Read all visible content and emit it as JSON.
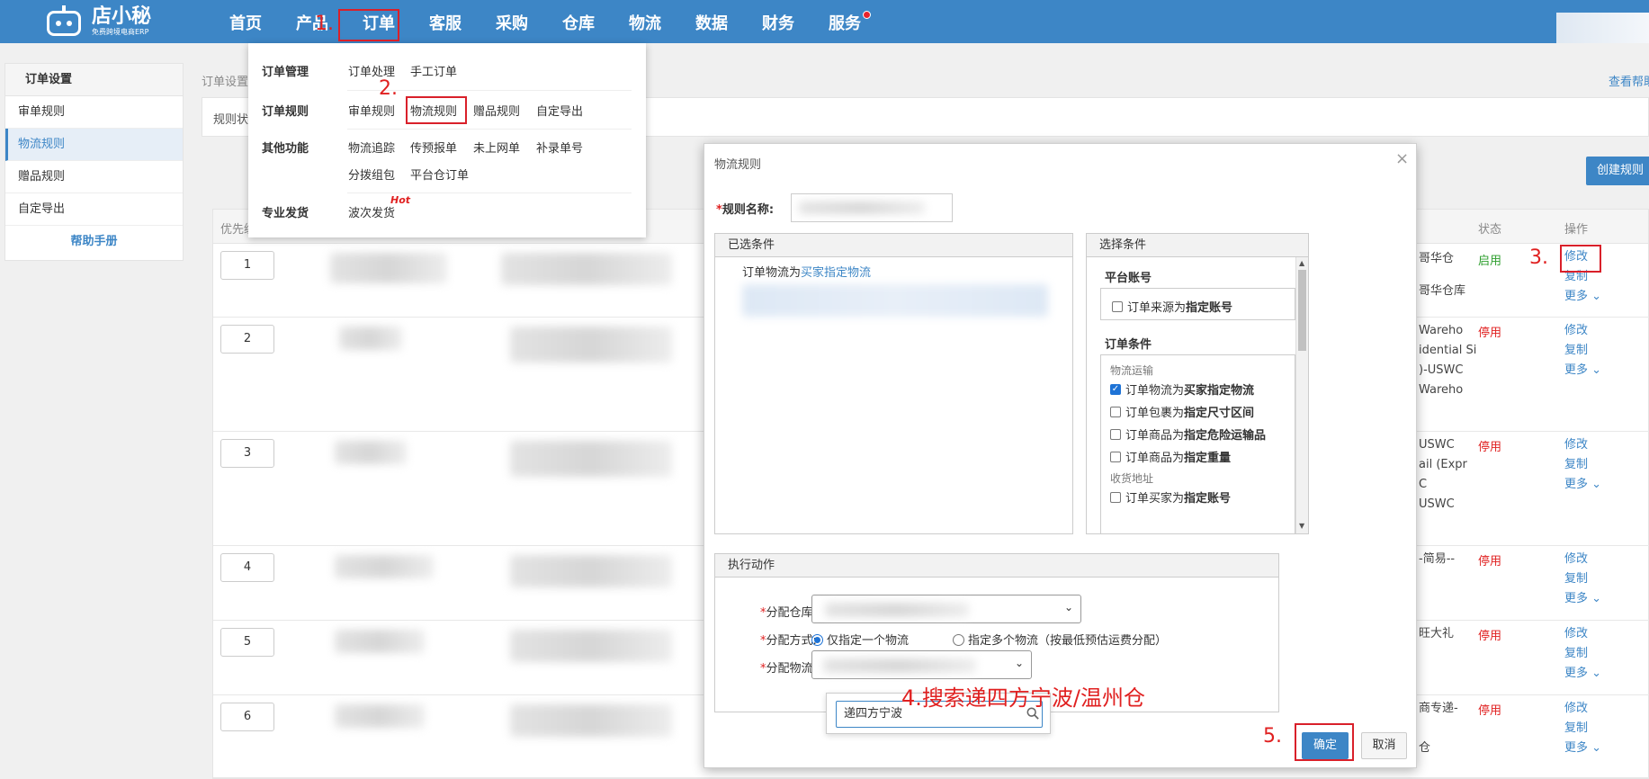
{
  "header": {
    "logo_name": "店小秘",
    "logo_sub": "免费跨境电商ERP",
    "nav": [
      "首页",
      "产品",
      "订单",
      "客服",
      "采购",
      "仓库",
      "物流",
      "数据",
      "财务",
      "服务"
    ]
  },
  "annotations": {
    "step1": "1.",
    "step2": "2.",
    "step3": "3.",
    "step4": "4.搜索递四方宁波/温州仓",
    "step5": "5."
  },
  "sidebar": {
    "title": "订单设置",
    "items": [
      "审单规则",
      "物流规则",
      "赠品规则",
      "自定导出"
    ],
    "active": "物流规则",
    "help": "帮助手册"
  },
  "page": {
    "breadcrumb": "订单设置",
    "help_link": "查看帮助",
    "status_label": "规则状",
    "create_button": "创建规则"
  },
  "table": {
    "col_priority": "优先级",
    "col_status": "状态",
    "col_ops": "操作",
    "op_edit": "修改",
    "op_copy": "复制",
    "op_more": "更多 ⌄",
    "rows": [
      {
        "priority": "1",
        "status": "启用",
        "active": true,
        "snippets": [
          "哥华仓",
          "哥华仓库"
        ]
      },
      {
        "priority": "2",
        "status": "停用",
        "active": false,
        "snippets": [
          "Wareho",
          "idential Si",
          ")-USWC",
          "Wareho"
        ]
      },
      {
        "priority": "3",
        "status": "停用",
        "active": false,
        "snippets": [
          "USWC",
          "ail (Expr",
          "C",
          "USWC"
        ]
      },
      {
        "priority": "4",
        "status": "停用",
        "active": false,
        "snippets": [
          "-简易--"
        ]
      },
      {
        "priority": "5",
        "status": "停用",
        "active": false,
        "snippets": [
          "旺大礼"
        ]
      },
      {
        "priority": "6",
        "status": "停用",
        "active": false,
        "snippets": [
          "商专递-",
          "仓"
        ]
      }
    ]
  },
  "dropdown": {
    "groups": [
      {
        "head": "订单管理",
        "links": [
          "订单处理",
          "手工订单"
        ]
      },
      {
        "head": "订单规则",
        "links": [
          "审单规则",
          "物流规则",
          "赠品规则",
          "自定导出"
        ]
      },
      {
        "head": "其他功能",
        "links": [
          "物流追踪",
          "传预报单",
          "未上网单",
          "补录单号",
          "分拨组包",
          "平台仓订单"
        ]
      },
      {
        "head": "专业发货",
        "links": [
          "波次发货"
        ]
      }
    ],
    "hot": "Hot"
  },
  "modal": {
    "title": "物流规则",
    "close": "×",
    "rule_name_label": "规则名称:",
    "required_mark": "*",
    "selected_panel_title": "已选条件",
    "selected_condition_prefix": "订单物流为",
    "selected_condition_link": "买家指定物流",
    "choose_panel_title": "选择条件",
    "platform_account_head": "平台账号",
    "platform_account_option_prefix": "订单来源为",
    "platform_account_option_bold": "指定账号",
    "order_condition_head": "订单条件",
    "group_logistics": "物流运输",
    "group_address": "收货地址",
    "options": [
      {
        "prefix": "订单物流为",
        "bold": "买家指定物流",
        "checked": true
      },
      {
        "prefix": "订单包裹为",
        "bold": "指定尺寸区间",
        "checked": false
      },
      {
        "prefix": "订单商品为",
        "bold": "指定危险运输品",
        "checked": false
      },
      {
        "prefix": "订单商品为",
        "bold": "指定重量",
        "checked": false
      },
      {
        "prefix": "订单买家为",
        "bold": "指定账号",
        "checked": false
      }
    ],
    "action_panel_title": "执行动作",
    "warehouse_label": "分配仓库:",
    "mode_label": "分配方式:",
    "mode_single": "仅指定一个物流",
    "mode_multi": "指定多个物流（按最低预估运费分配）",
    "logistics_label": "分配物流:",
    "search_value": "递四方宁波",
    "ok_button": "确定",
    "cancel_button": "取消"
  }
}
